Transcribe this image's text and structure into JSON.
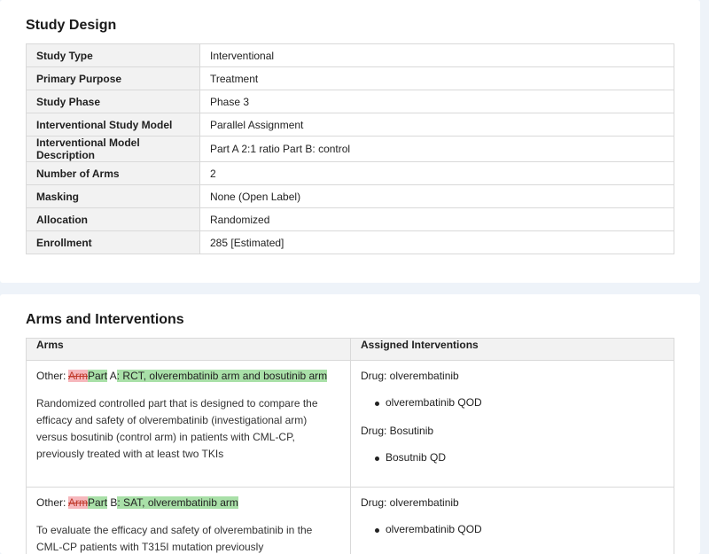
{
  "study_design": {
    "title": "Study Design",
    "rows": [
      {
        "label": "Study Type",
        "value": "Interventional"
      },
      {
        "label": "Primary Purpose",
        "value": "Treatment"
      },
      {
        "label": "Study Phase",
        "value": "Phase 3"
      },
      {
        "label": "Interventional Study Model",
        "value": "Parallel Assignment"
      },
      {
        "label": "Interventional Model Description",
        "value": "Part A 2:1 ratio Part B: control"
      },
      {
        "label": "Number of Arms",
        "value": "2"
      },
      {
        "label": "Masking",
        "value": "None (Open Label)"
      },
      {
        "label": "Allocation",
        "value": "Randomized"
      },
      {
        "label": "Enrollment",
        "value": "285 [Estimated]"
      }
    ]
  },
  "arms_interventions": {
    "title": "Arms and Interventions",
    "col_arms": "Arms",
    "col_interventions": "Assigned Interventions",
    "arms": [
      {
        "prefix": "Other: ",
        "deleted": "Arm",
        "inserted_1": "Part",
        "mid": " A",
        "inserted_2": ": RCT, olverembatinib arm and bosutinib arm",
        "description": "Randomized controlled part that is designed to compare the efficacy and safety of olverembatinib (investigational arm) versus bosutinib (control arm) in patients with CML-CP, previously treated with at least two TKIs",
        "interventions": [
          {
            "drug": "Drug: olverembatinib",
            "dose": "olverembatinib QOD"
          },
          {
            "drug": "Drug: Bosutinib",
            "dose": "Bosutnib QD"
          }
        ]
      },
      {
        "prefix": "Other: ",
        "deleted": "Arm",
        "inserted_1": "Part",
        "mid": " B",
        "inserted_2": ": SAT, olverembatinib arm",
        "description": "To evaluate the efficacy and safety of olverembatinib in the CML-CP patients with T315I mutation previously",
        "interventions": [
          {
            "drug": "Drug: olverembatinib",
            "dose": "olverembatinib QOD"
          }
        ]
      }
    ]
  }
}
